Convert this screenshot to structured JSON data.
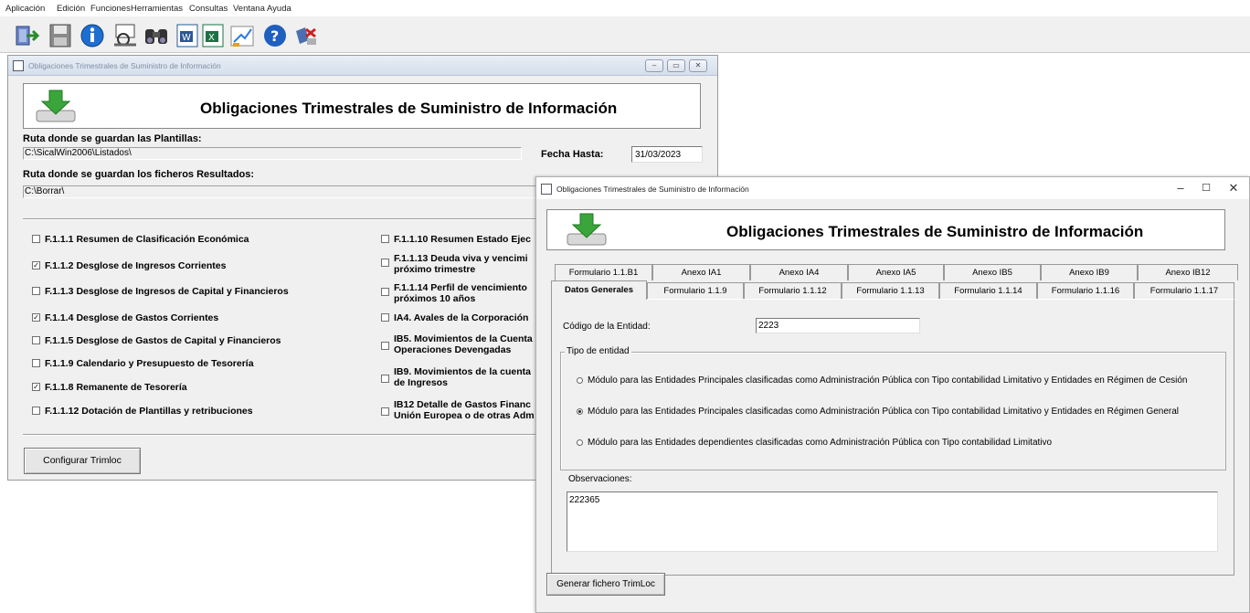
{
  "menu": [
    "Aplicación",
    "Edición",
    "Funciones",
    "Herramientas",
    "Consultas",
    "Ventana",
    "Ayuda"
  ],
  "toolbar": {
    "icons": [
      "exit-icon",
      "save-disk-icon",
      "info-icon",
      "print-preview-icon",
      "binoculars-icon",
      "word-export-icon",
      "excel-export-icon",
      "chart-edit-icon",
      "help-icon",
      "mail-delete-icon"
    ]
  },
  "win1": {
    "title": "Obligaciones Trimestrales de Suministro de Información",
    "header_title": "Obligaciones Trimestrales de Suministro de Información",
    "ruta_plantillas_label": "Ruta donde se guardan las Plantillas:",
    "ruta_plantillas_value": "C:\\SicalWin2006\\Listados\\",
    "fecha_hasta_label": "Fecha Hasta:",
    "fecha_hasta_value": "31/03/2023",
    "ruta_resultados_label": "Ruta donde se guardan los ficheros Resultados:",
    "ruta_resultados_value": "C:\\Borrar\\",
    "checks_left": [
      {
        "label": "F.1.1.1 Resumen de Clasificación Económica",
        "checked": false
      },
      {
        "label": "F.1.1.2 Desglose de Ingresos Corrientes",
        "checked": true
      },
      {
        "label": "F.1.1.3 Desglose de Ingresos de Capital y Financieros",
        "checked": false
      },
      {
        "label": "F.1.1.4 Desglose de Gastos Corrientes",
        "checked": true
      },
      {
        "label": "F.1.1.5 Desglose de Gastos de Capital y Financieros",
        "checked": false
      },
      {
        "label": "F.1.1.9 Calendario y Presupuesto de Tesorería",
        "checked": false
      },
      {
        "label": "F.1.1.8 Remanente de Tesorería",
        "checked": true
      },
      {
        "label": "F.1.1.12 Dotación de Plantillas y retribuciones",
        "checked": false
      }
    ],
    "checks_right": [
      {
        "line1": "F.1.1.10 Resumen Estado Ejec",
        "line2": "",
        "checked": false
      },
      {
        "line1": "F.1.1.13 Deuda viva y vencimi",
        "line2": "próximo trimestre",
        "checked": false
      },
      {
        "line1": "F.1.1.14 Perfil de vencimiento",
        "line2": "próximos 10 años",
        "checked": false
      },
      {
        "line1": "IA4. Avales de la Corporación",
        "line2": "",
        "checked": false
      },
      {
        "line1": "IB5. Movimientos de la Cuenta",
        "line2": "Operaciones Devengadas",
        "checked": false
      },
      {
        "line1": "IB9. Movimientos de la cuenta",
        "line2": "de Ingresos",
        "checked": false
      },
      {
        "line1": "IB12 Detalle de Gastos Financ",
        "line2": "Unión Europea o de otras Adm",
        "checked": false
      }
    ],
    "configurar_button": "Configurar Trimloc"
  },
  "win2": {
    "title": "Obligaciones Trimestrales de Suministro de Información",
    "header_title": "Obligaciones Trimestrales de Suministro de Información",
    "tabs_row1": [
      "Formulario 1.1.B1",
      "Anexo IA1",
      "Anexo IA4",
      "Anexo IA5",
      "Anexo IB5",
      "Anexo IB9",
      "Anexo IB12"
    ],
    "tabs_row2": [
      "Datos Generales",
      "Formulario 1.1.9",
      "Formulario 1.1.12",
      "Formulario 1.1.13",
      "Formulario 1.1.14",
      "Formulario 1.1.16",
      "Formulario 1.1.17"
    ],
    "codigo_label": "Código de la Entidad:",
    "codigo_value": "2223",
    "tipo_legend": "Tipo de entidad",
    "radios": [
      {
        "label": "Módulo para las Entidades Principales clasificadas como Administración Pública con Tipo contabilidad Limitativo y Entidades en Régimen de Cesión",
        "selected": false
      },
      {
        "label": "Módulo para las Entidades Principales clasificadas como Administración Pública con Tipo contabilidad Limitativo y Entidades en Régimen General",
        "selected": true
      },
      {
        "label": "Módulo para las Entidades dependientes clasificadas como Administración Pública con Tipo contabilidad Limitativo",
        "selected": false
      }
    ],
    "observaciones_label": "Observaciones:",
    "observaciones_value": "222365",
    "generar_button": "Generar fichero TrimLoc"
  }
}
